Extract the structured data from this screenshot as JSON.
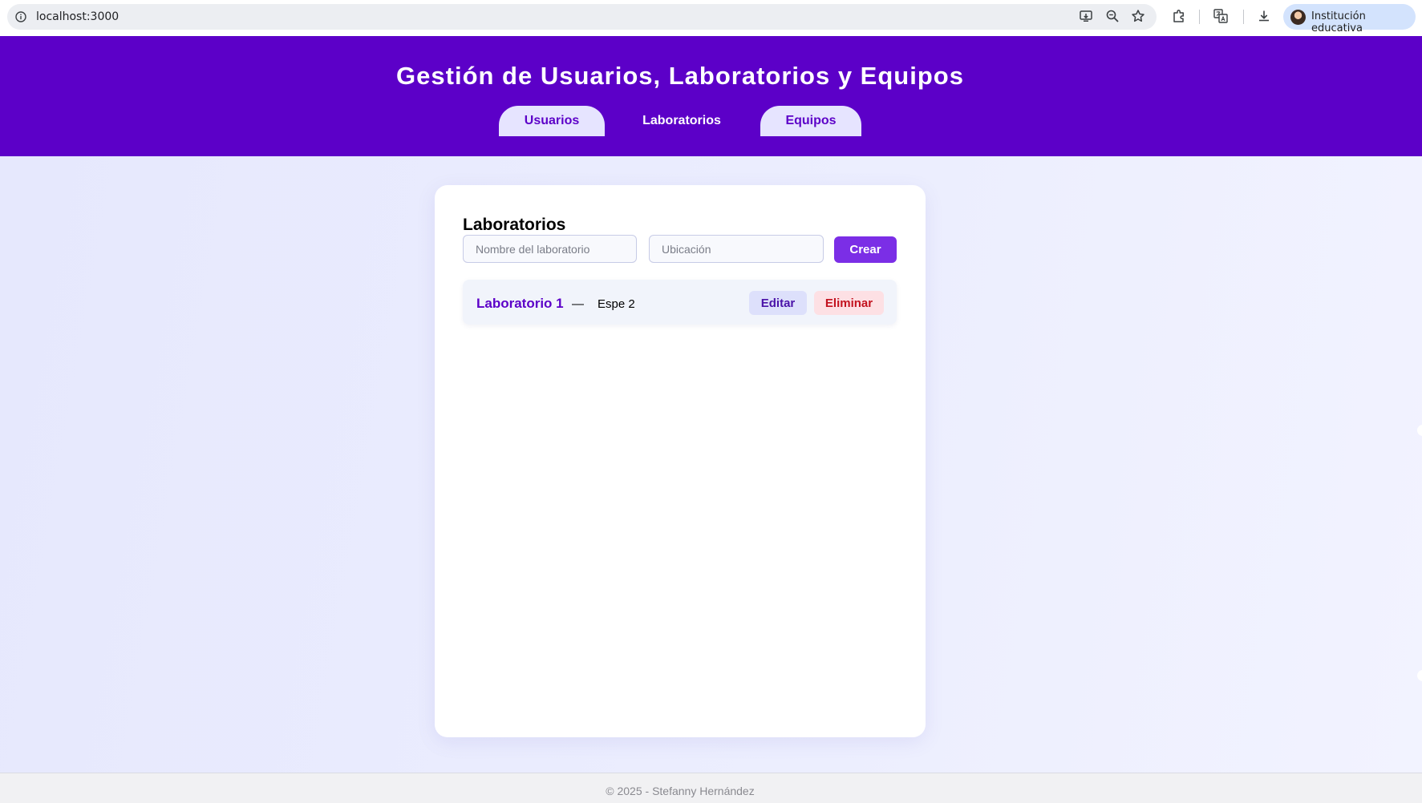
{
  "browser": {
    "url": "localhost:3000",
    "profile_name": "Institución educativa",
    "icons": [
      "info-icon",
      "install-app-icon",
      "zoom-icon",
      "bookmark-star-icon",
      "extensions-icon",
      "translate-icon",
      "download-icon"
    ]
  },
  "header": {
    "title": "Gestión de Usuarios, Laboratorios y Equipos",
    "tabs": [
      {
        "label": "Usuarios",
        "active": false
      },
      {
        "label": "Laboratorios",
        "active": true
      },
      {
        "label": "Equipos",
        "active": false
      }
    ]
  },
  "laboratorios": {
    "heading": "Laboratorios",
    "form": {
      "name_placeholder": "Nombre del laboratorio",
      "name_value": "",
      "location_placeholder": "Ubicación",
      "location_value": "",
      "create_label": "Crear"
    },
    "items": [
      {
        "name": "Laboratorio 1",
        "separator": "—",
        "location": "Espe 2",
        "edit_label": "Editar",
        "delete_label": "Eliminar"
      }
    ]
  },
  "footer": {
    "text": "© 2025 - Stefanny Hernández"
  },
  "colors": {
    "header_bg": "#5c00c8",
    "accent": "#7b2ee6",
    "tab_inactive_bg": "#e6e4ff",
    "edit_bg": "#dde0fb",
    "delete_bg": "#fde0e4",
    "delete_text": "#c3121f"
  }
}
